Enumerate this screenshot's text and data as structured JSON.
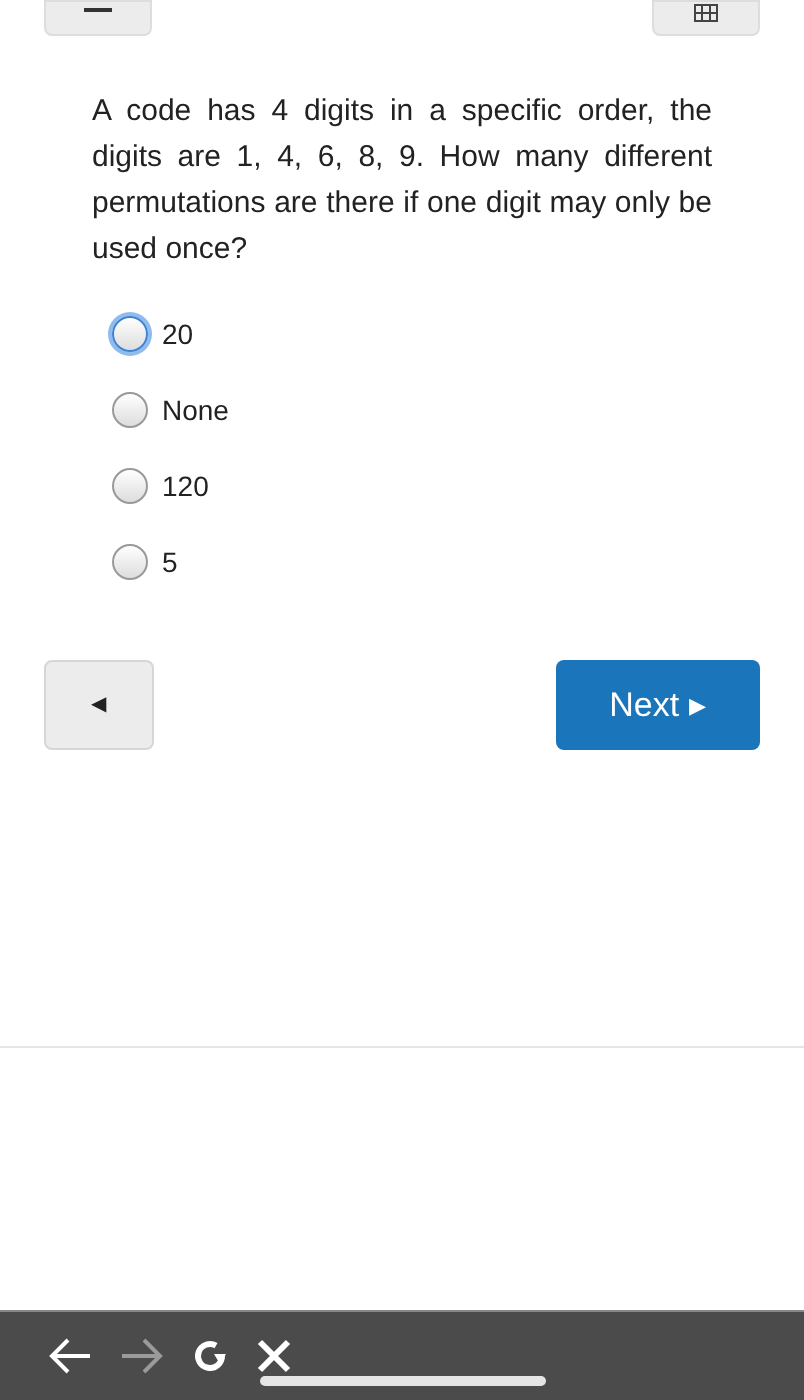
{
  "question": "A code has 4 digits in a specific order, the digits are 1, 4, 6, 8, 9. How many different permutations are there if one digit may only be used once?",
  "options": [
    {
      "label": "20",
      "selected": false,
      "focused": true
    },
    {
      "label": "None",
      "selected": false,
      "focused": false
    },
    {
      "label": "120",
      "selected": false,
      "focused": false
    },
    {
      "label": "5",
      "selected": false,
      "focused": false
    }
  ],
  "back_button": {
    "label": "◀"
  },
  "next_button": {
    "label": "Next ▸"
  },
  "browser_bar": {
    "forward_disabled": true
  }
}
